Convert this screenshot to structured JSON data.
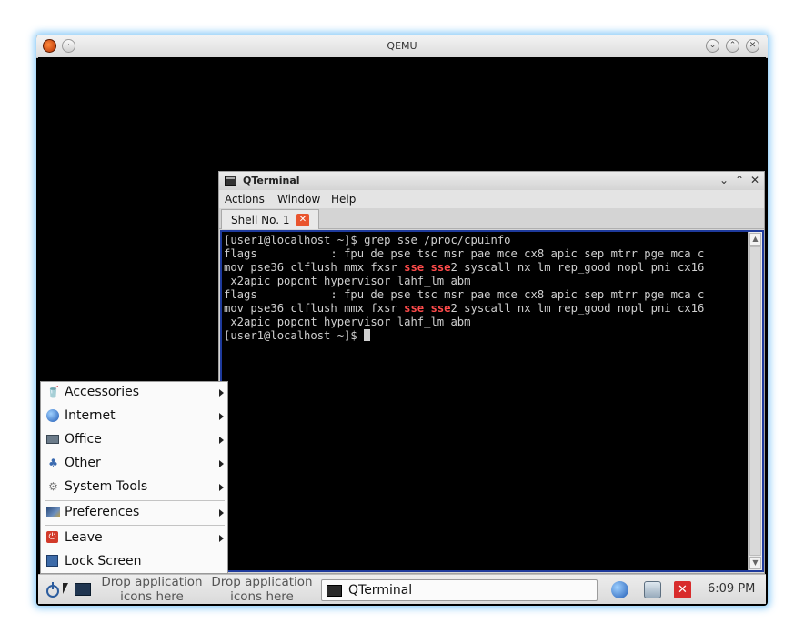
{
  "qemu": {
    "title": "QEMU"
  },
  "qterminal": {
    "title": "QTerminal",
    "menu": [
      "Actions",
      "Window",
      "Help"
    ],
    "tab_label": "Shell No. 1",
    "lines": [
      [
        {
          "t": "[user1@localhost ~]$ grep sse /proc/cpuinfo"
        }
      ],
      [
        {
          "t": "flags           : fpu de pse tsc msr pae mce cx8 apic sep mtrr pge mca c"
        }
      ],
      [
        {
          "t": "mov pse36 clflush mmx fxsr "
        },
        {
          "t": "sse",
          "hl": true
        },
        {
          "t": " "
        },
        {
          "t": "sse",
          "hl": true
        },
        {
          "t": "2 syscall nx lm rep_good nopl pni cx16"
        }
      ],
      [
        {
          "t": " x2apic popcnt hypervisor lahf_lm abm"
        }
      ],
      [
        {
          "t": "flags           : fpu de pse tsc msr pae mce cx8 apic sep mtrr pge mca c"
        }
      ],
      [
        {
          "t": "mov pse36 clflush mmx fxsr "
        },
        {
          "t": "sse",
          "hl": true
        },
        {
          "t": " "
        },
        {
          "t": "sse",
          "hl": true
        },
        {
          "t": "2 syscall nx lm rep_good nopl pni cx16"
        }
      ],
      [
        {
          "t": " x2apic popcnt hypervisor lahf_lm abm"
        }
      ],
      [
        {
          "t": "[user1@localhost ~]$ "
        },
        {
          "cursor": true
        }
      ]
    ]
  },
  "start_menu": {
    "items": [
      {
        "label": "Accessories",
        "icon": "accessories-icon",
        "submenu": true
      },
      {
        "label": "Internet",
        "icon": "internet-globe-icon",
        "submenu": true
      },
      {
        "label": "Office",
        "icon": "office-icon",
        "submenu": true
      },
      {
        "label": "Other",
        "icon": "other-icon",
        "submenu": true
      },
      {
        "label": "System Tools",
        "icon": "system-tools-gear-icon",
        "submenu": true
      },
      {
        "label": "Preferences",
        "icon": "preferences-icon",
        "submenu": true
      },
      {
        "label": "Leave",
        "icon": "power-icon",
        "submenu": true
      },
      {
        "label": "Lock Screen",
        "icon": "lock-screen-icon",
        "submenu": false
      }
    ]
  },
  "taskbar": {
    "drop_zones": [
      "Drop application icons here",
      "Drop application icons here"
    ],
    "task_label": "QTerminal",
    "clock": "6:09 PM",
    "tray_icons": [
      "globe-icon",
      "network-icon",
      "close-red-icon"
    ]
  }
}
